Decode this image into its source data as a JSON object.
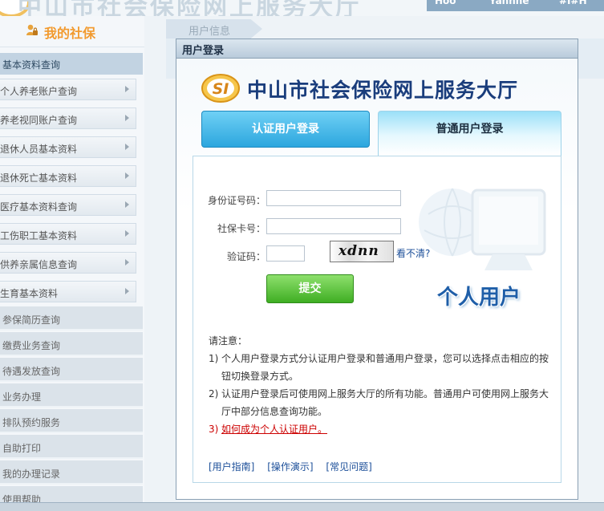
{
  "top": {
    "title_faded": "中山市社会保险网上服务大厅",
    "nav_items": [
      "Hoo",
      "Yahnne",
      "#I#H"
    ]
  },
  "sidebar": {
    "title": "我的社保",
    "section": "基本资料查询",
    "items": [
      {
        "label": "个人养老账户查询"
      },
      {
        "label": "养老视同账户查询"
      },
      {
        "label": "退休人员基本资料"
      },
      {
        "label": "退休死亡基本资料"
      },
      {
        "label": "医疗基本资料查询"
      },
      {
        "label": "工伤职工基本资料"
      },
      {
        "label": "供养亲属信息查询"
      },
      {
        "label": "生育基本资料"
      }
    ],
    "plain_items": [
      {
        "label": "参保简历查询"
      },
      {
        "label": "缴费业务查询"
      },
      {
        "label": "待遇发放查询"
      },
      {
        "label": "业务办理"
      },
      {
        "label": "排队预约服务"
      },
      {
        "label": "自助打印"
      },
      {
        "label": "我的办理记录"
      },
      {
        "label": "使用帮助"
      }
    ]
  },
  "user_info_tab": "用户信息",
  "dialog": {
    "title": "用户登录",
    "brand_title": "中山市社会保险网上服务大厅",
    "brand_logo_text": "SI",
    "tabs": {
      "cert": "认证用户登录",
      "normal": "普通用户登录"
    },
    "form": {
      "id_label": "身份证号码：",
      "id_value": "",
      "card_label": "社保卡号：",
      "card_value": "",
      "captcha_label": "验证码：",
      "captcha_value": "",
      "captcha_text": "xdnn",
      "refresh_link": "看不清?",
      "submit": "提交"
    },
    "personal_user": "个人用户",
    "notes": {
      "heading": "请注意：",
      "n1_num": "1)",
      "n1": "个人用户登录方式分认证用户登录和普通用户登录，您可以选择点击相应的按钮切换登录方式。",
      "n2_num": "2)",
      "n2": "认证用户登录后可使用网上服务大厅的所有功能。普通用户可使用网上服务大厅中部分信息查询功能。",
      "n3_num": "3)",
      "n3_link": "如何成为个人认证用户。"
    },
    "footer_links": [
      "[用户指南]",
      "[操作演示]",
      "[常见问题]"
    ]
  },
  "colors": {
    "brand_blue": "#1a3d7c",
    "sidebar_title_orange": "#f29a2e",
    "tab_blue": "#2ca6de",
    "submit_green": "#3fae23",
    "alert_red": "#cc0000"
  }
}
